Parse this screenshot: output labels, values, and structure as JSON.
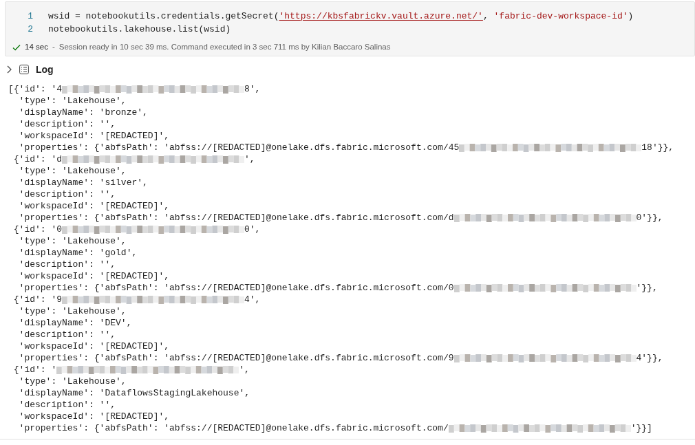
{
  "cell": {
    "lines": [
      {
        "number": "1",
        "parts": [
          {
            "kind": "plain",
            "text": "wsid = notebookutils.credentials.getSecret("
          },
          {
            "kind": "link",
            "text": "'https://kbsfabrickv.vault.azure.net/'"
          },
          {
            "kind": "plain",
            "text": ", "
          },
          {
            "kind": "string",
            "text": "'fabric-dev-workspace-id'"
          },
          {
            "kind": "plain",
            "text": ")"
          }
        ]
      },
      {
        "number": "2",
        "parts": [
          {
            "kind": "plain",
            "text": "notebookutils.lakehouse.list(wsid)"
          }
        ]
      }
    ],
    "status": {
      "succeeded": true,
      "duration": "14 sec",
      "separator": "-",
      "message": "Session ready in 10 sec 39 ms. Command executed in 3 sec 711 ms by Kilian Baccaro Salinas"
    }
  },
  "output": {
    "expanded": false,
    "label": "Log",
    "lines": [
      {
        "parts": [
          {
            "kind": "text",
            "text": "[{'id': '4"
          },
          {
            "kind": "blur"
          },
          {
            "kind": "text",
            "text": "8',"
          }
        ]
      },
      {
        "parts": [
          {
            "kind": "text",
            "text": "  'type': 'Lakehouse',"
          }
        ]
      },
      {
        "parts": [
          {
            "kind": "text",
            "text": "  'displayName': 'bronze',"
          }
        ]
      },
      {
        "parts": [
          {
            "kind": "text",
            "text": "  'description': '',"
          }
        ]
      },
      {
        "parts": [
          {
            "kind": "text",
            "text": "  'workspaceId': '[REDACTED]',"
          }
        ]
      },
      {
        "parts": [
          {
            "kind": "text",
            "text": "  'properties': {'abfsPath': 'abfss://[REDACTED]@onelake.dfs.fabric.microsoft.com/45"
          },
          {
            "kind": "blur"
          },
          {
            "kind": "text",
            "text": "18'}},"
          }
        ]
      },
      {
        "parts": [
          {
            "kind": "text",
            "text": " {'id': 'd"
          },
          {
            "kind": "blur"
          },
          {
            "kind": "text",
            "text": "',"
          }
        ]
      },
      {
        "parts": [
          {
            "kind": "text",
            "text": "  'type': 'Lakehouse',"
          }
        ]
      },
      {
        "parts": [
          {
            "kind": "text",
            "text": "  'displayName': 'silver',"
          }
        ]
      },
      {
        "parts": [
          {
            "kind": "text",
            "text": "  'description': '',"
          }
        ]
      },
      {
        "parts": [
          {
            "kind": "text",
            "text": "  'workspaceId': '[REDACTED]',"
          }
        ]
      },
      {
        "parts": [
          {
            "kind": "text",
            "text": "  'properties': {'abfsPath': 'abfss://[REDACTED]@onelake.dfs.fabric.microsoft.com/d"
          },
          {
            "kind": "blur"
          },
          {
            "kind": "text",
            "text": "0'}},"
          }
        ]
      },
      {
        "parts": [
          {
            "kind": "text",
            "text": " {'id': '0"
          },
          {
            "kind": "blur"
          },
          {
            "kind": "text",
            "text": "0',"
          }
        ]
      },
      {
        "parts": [
          {
            "kind": "text",
            "text": "  'type': 'Lakehouse',"
          }
        ]
      },
      {
        "parts": [
          {
            "kind": "text",
            "text": "  'displayName': 'gold',"
          }
        ]
      },
      {
        "parts": [
          {
            "kind": "text",
            "text": "  'description': '',"
          }
        ]
      },
      {
        "parts": [
          {
            "kind": "text",
            "text": "  'workspaceId': '[REDACTED]',"
          }
        ]
      },
      {
        "parts": [
          {
            "kind": "text",
            "text": "  'properties': {'abfsPath': 'abfss://[REDACTED]@onelake.dfs.fabric.microsoft.com/0"
          },
          {
            "kind": "blur"
          },
          {
            "kind": "text",
            "text": "'}},"
          }
        ]
      },
      {
        "parts": [
          {
            "kind": "text",
            "text": " {'id': '9"
          },
          {
            "kind": "blur"
          },
          {
            "kind": "text",
            "text": "4',"
          }
        ]
      },
      {
        "parts": [
          {
            "kind": "text",
            "text": "  'type': 'Lakehouse',"
          }
        ]
      },
      {
        "parts": [
          {
            "kind": "text",
            "text": "  'displayName': 'DEV',"
          }
        ]
      },
      {
        "parts": [
          {
            "kind": "text",
            "text": "  'description': '',"
          }
        ]
      },
      {
        "parts": [
          {
            "kind": "text",
            "text": "  'workspaceId': '[REDACTED]',"
          }
        ]
      },
      {
        "parts": [
          {
            "kind": "text",
            "text": "  'properties': {'abfsPath': 'abfss://[REDACTED]@onelake.dfs.fabric.microsoft.com/9"
          },
          {
            "kind": "blur"
          },
          {
            "kind": "text",
            "text": "4'}},"
          }
        ]
      },
      {
        "parts": [
          {
            "kind": "text",
            "text": " {'id': '"
          },
          {
            "kind": "blur"
          },
          {
            "kind": "text",
            "text": "',"
          }
        ]
      },
      {
        "parts": [
          {
            "kind": "text",
            "text": "  'type': 'Lakehouse',"
          }
        ]
      },
      {
        "parts": [
          {
            "kind": "text",
            "text": "  'displayName': 'DataflowsStagingLakehouse',"
          }
        ]
      },
      {
        "parts": [
          {
            "kind": "text",
            "text": "  'description': '',"
          }
        ]
      },
      {
        "parts": [
          {
            "kind": "text",
            "text": "  'workspaceId': '[REDACTED]',"
          }
        ]
      },
      {
        "parts": [
          {
            "kind": "text",
            "text": "  'properties': {'abfsPath': 'abfss://[REDACTED]@onelake.dfs.fabric.microsoft.com/"
          },
          {
            "kind": "blur"
          },
          {
            "kind": "text",
            "text": "'}}]"
          }
        ]
      }
    ]
  }
}
